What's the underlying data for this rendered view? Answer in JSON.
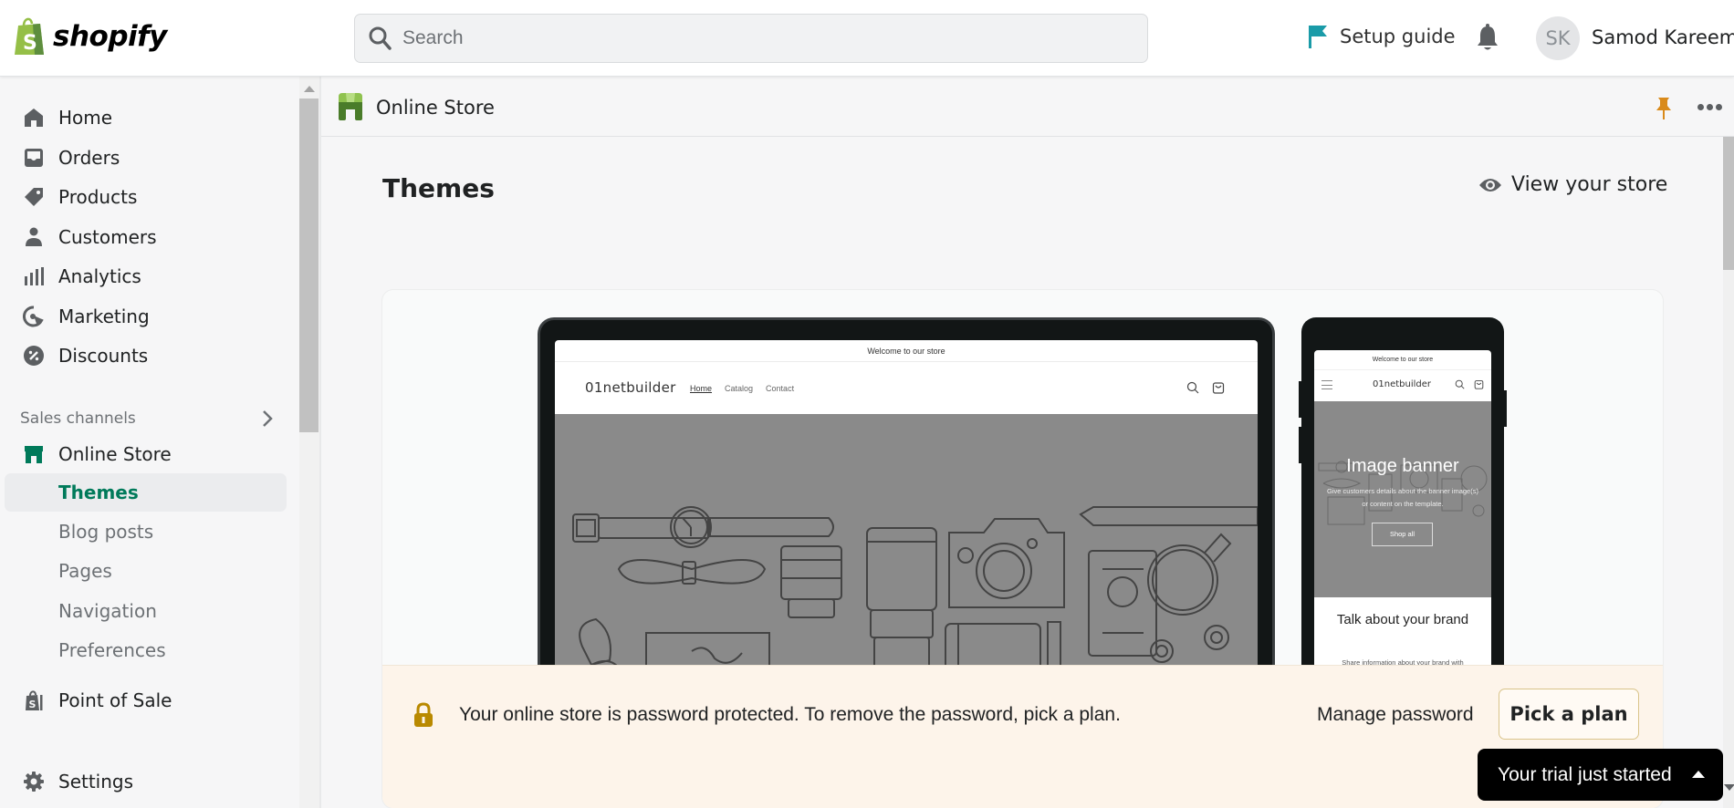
{
  "topbar": {
    "logo_text": "shopify",
    "search": {
      "placeholder": "Search",
      "value": ""
    },
    "setup_guide": "Setup guide",
    "avatar_initials": "SK",
    "user_name": "Samod Kareem"
  },
  "sidebar": {
    "items": [
      {
        "label": "Home",
        "icon": "home-icon"
      },
      {
        "label": "Orders",
        "icon": "orders-icon"
      },
      {
        "label": "Products",
        "icon": "tag-icon"
      },
      {
        "label": "Customers",
        "icon": "person-icon"
      },
      {
        "label": "Analytics",
        "icon": "analytics-icon"
      },
      {
        "label": "Marketing",
        "icon": "marketing-icon"
      },
      {
        "label": "Discounts",
        "icon": "discount-icon"
      }
    ],
    "sales_channels_label": "Sales channels",
    "online_store": {
      "label": "Online Store",
      "children": [
        "Themes",
        "Blog posts",
        "Pages",
        "Navigation",
        "Preferences"
      ],
      "active": "Themes"
    },
    "point_of_sale": "Point of Sale",
    "settings": "Settings"
  },
  "main": {
    "subheader_title": "Online Store",
    "page_title": "Themes",
    "view_store": "View your store",
    "preview": {
      "announcement": "Welcome to our store",
      "store_name": "01netbuilder",
      "nav_links": [
        "Home",
        "Catalog",
        "Contact"
      ],
      "mobile": {
        "banner_title": "Image banner",
        "banner_text": "Give customers details about the banner image(s) or content on the template.",
        "banner_button": "Shop all",
        "brand_heading": "Talk about your brand",
        "brand_text": "Share information about your brand with"
      }
    },
    "password_banner": {
      "message": "Your online store is password protected. To remove the password, pick a plan.",
      "manage_password": "Manage password",
      "pick_plan": "Pick a plan"
    }
  },
  "trial": {
    "label": "Your trial just started"
  },
  "colors": {
    "accent_green": "#007a5a",
    "brand_green": "#95bf47",
    "setup_flag": "#1a9ba8",
    "pin_orange": "#d98a1a",
    "banner_bg": "#fdf4ea"
  }
}
